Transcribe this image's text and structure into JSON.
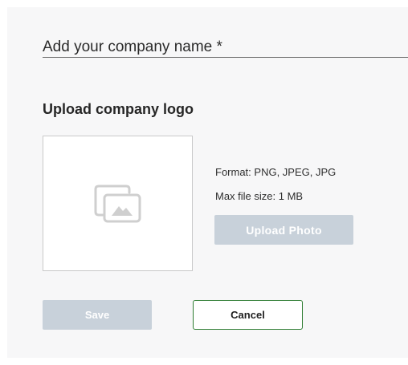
{
  "form": {
    "company_name_label": "Add your company name *"
  },
  "logo_upload": {
    "title": "Upload company logo",
    "format_text": "Format: PNG, JPEG, JPG",
    "max_size_text": "Max file size: 1 MB",
    "upload_button_label": "Upload Photo",
    "placeholder_icon": "image-gallery-icon"
  },
  "actions": {
    "save_label": "Save",
    "cancel_label": "Cancel"
  },
  "colors": {
    "disabled_button_bg": "#c8d1da",
    "cancel_border": "#2e7d32",
    "panel_bg": "#f7f7f8"
  }
}
